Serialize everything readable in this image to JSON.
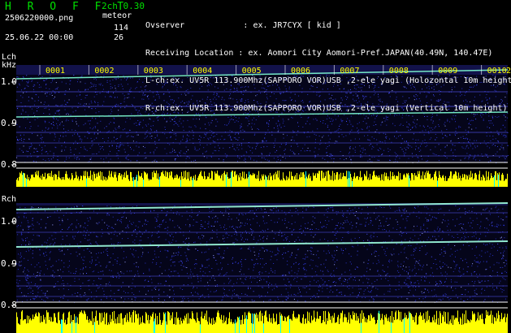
{
  "header": {
    "title": "H R O F F T",
    "version": "2ch 0.30",
    "filename": "2506220000.png",
    "meteor_label": "meteor",
    "count_l": "114",
    "count_r": "26",
    "datetime": "25.06.22 00:00"
  },
  "info": {
    "observer": "Ovserver            : ex. JR7CYX [ kid ]",
    "location": "Receiving Location : ex. Aomori City Aomori-Pref.JAPAN(40.49N, 140.47E)",
    "lch": "L-ch:ex. UV5R 113.900Mhz(SAPPORO VOR)USB ,2-ele yagi (Holozontal 10m height",
    "rch": "R-ch:ex. UV5R 113.900Mhz(SAPPORO VOR)USB ,2-ele yagi (Vertical 10m height)"
  },
  "lch": {
    "label": "Lch",
    "unit": "kHz",
    "ticks": [
      "1.0",
      "0.9",
      "0.8"
    ]
  },
  "rch": {
    "label": "Rch",
    "ticks": [
      "1.0",
      "0.9",
      "0.8"
    ]
  },
  "minutes": [
    "0001",
    "0002",
    "0003",
    "0004",
    "0005",
    "0006",
    "0007",
    "0008",
    "0009",
    "0010"
  ],
  "edge_label": "2",
  "colors": {
    "header_green": "#00e000",
    "grid_blue": "#0000ff",
    "noise_blue": "#2a32c8",
    "bar_yellow": "#ffff00",
    "bar_cyan": "#00ffff"
  }
}
